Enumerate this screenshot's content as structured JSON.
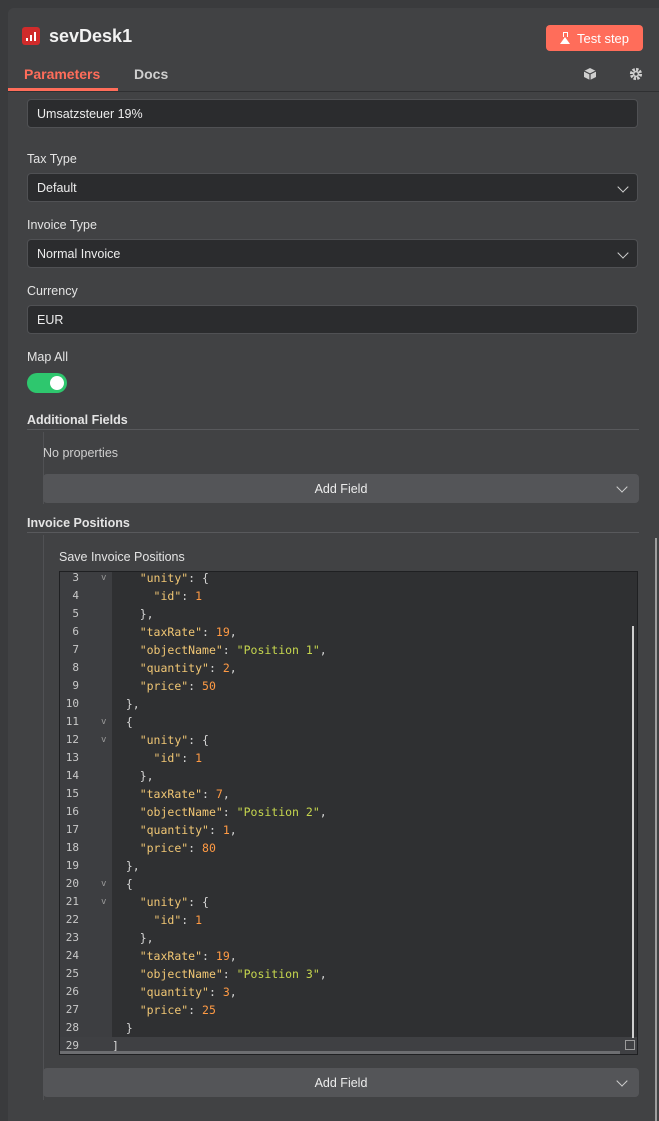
{
  "header": {
    "title": "sevDesk1",
    "test_step_label": "Test step",
    "tabs": [
      {
        "label": "Parameters",
        "active": true
      },
      {
        "label": "Docs",
        "active": false
      }
    ],
    "icons": [
      "cube-icon",
      "gear-icon"
    ]
  },
  "fields": {
    "tax_text_value": "Umsatzsteuer 19%",
    "tax_type_label": "Tax Type",
    "tax_type_value": "Default",
    "invoice_type_label": "Invoice Type",
    "invoice_type_value": "Normal Invoice",
    "currency_label": "Currency",
    "currency_value": "EUR",
    "map_all_label": "Map All",
    "map_all_on": true
  },
  "additional_fields": {
    "title": "Additional Fields",
    "empty_text": "No properties",
    "add_field_label": "Add Field"
  },
  "invoice_positions": {
    "title": "Invoice Positions",
    "save_label": "Save Invoice Positions",
    "add_field_label": "Add Field",
    "code_lines": [
      {
        "num": "3",
        "fold": "v",
        "code": "    \"unity\": {"
      },
      {
        "num": "4",
        "fold": "",
        "code": "      \"id\": 1"
      },
      {
        "num": "5",
        "fold": "",
        "code": "    },"
      },
      {
        "num": "6",
        "fold": "",
        "code": "    \"taxRate\": 19,"
      },
      {
        "num": "7",
        "fold": "",
        "code": "    \"objectName\": \"Position 1\","
      },
      {
        "num": "8",
        "fold": "",
        "code": "    \"quantity\": 2,"
      },
      {
        "num": "9",
        "fold": "",
        "code": "    \"price\": 50"
      },
      {
        "num": "10",
        "fold": "",
        "code": "  },"
      },
      {
        "num": "11",
        "fold": "v",
        "code": "  {"
      },
      {
        "num": "12",
        "fold": "v",
        "code": "    \"unity\": {"
      },
      {
        "num": "13",
        "fold": "",
        "code": "      \"id\": 1"
      },
      {
        "num": "14",
        "fold": "",
        "code": "    },"
      },
      {
        "num": "15",
        "fold": "",
        "code": "    \"taxRate\": 7,"
      },
      {
        "num": "16",
        "fold": "",
        "code": "    \"objectName\": \"Position 2\","
      },
      {
        "num": "17",
        "fold": "",
        "code": "    \"quantity\": 1,"
      },
      {
        "num": "18",
        "fold": "",
        "code": "    \"price\": 80"
      },
      {
        "num": "19",
        "fold": "",
        "code": "  },"
      },
      {
        "num": "20",
        "fold": "v",
        "code": "  {"
      },
      {
        "num": "21",
        "fold": "v",
        "code": "    \"unity\": {"
      },
      {
        "num": "22",
        "fold": "",
        "code": "      \"id\": 1"
      },
      {
        "num": "23",
        "fold": "",
        "code": "    },"
      },
      {
        "num": "24",
        "fold": "",
        "code": "    \"taxRate\": 19,"
      },
      {
        "num": "25",
        "fold": "",
        "code": "    \"objectName\": \"Position 3\","
      },
      {
        "num": "26",
        "fold": "",
        "code": "    \"quantity\": 3,"
      },
      {
        "num": "27",
        "fold": "",
        "code": "    \"price\": 25"
      },
      {
        "num": "28",
        "fold": "",
        "code": "  }"
      },
      {
        "num": "29",
        "fold": "",
        "code": "]",
        "active": true
      }
    ]
  },
  "colors": {
    "accent": "#ff6d5a",
    "toggle_on": "#2ec76e",
    "node_icon": "#d02b2b"
  }
}
